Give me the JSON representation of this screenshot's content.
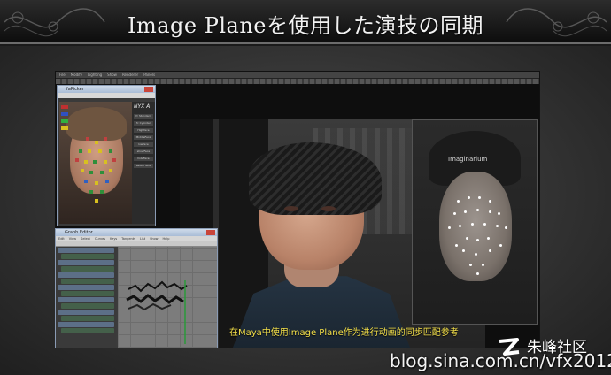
{
  "slide": {
    "title": "Image Planeを使用した演技の同期",
    "caption": "在Maya中使用Image Plane作为进行动画的同步匹配参考"
  },
  "maya": {
    "menu": [
      "File",
      "Modify",
      "Lighting",
      "Show",
      "Renderer",
      "Panels"
    ]
  },
  "picker_window": {
    "title": "faPicker",
    "logo": "NYX A",
    "buttons": [
      "fc Standard",
      "fc Cylinder",
      "Highface",
      "MiddleFace",
      "lowface",
      "showFace",
      "hideFace",
      "select face"
    ]
  },
  "graph_editor": {
    "title": "Graph Editor",
    "menu": [
      "Edit",
      "View",
      "Select",
      "Curves",
      "Keys",
      "Tangents",
      "List",
      "Show",
      "Help"
    ]
  },
  "video": {
    "cap_label": "Imaginarium"
  },
  "watermark": {
    "url": "blog.sina.com.cn/vfx2012",
    "brand": "朱峰社区"
  },
  "colors": {
    "caption": "#f4e04a",
    "header_bg": "#111111"
  }
}
